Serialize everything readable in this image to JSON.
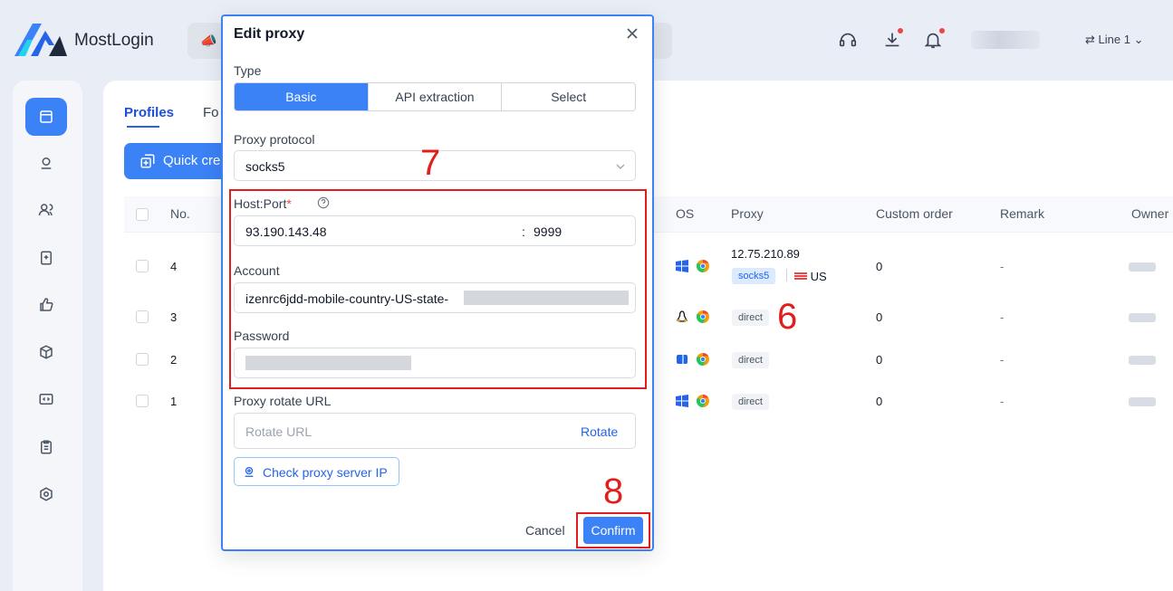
{
  "app": {
    "brand": "MostLogin",
    "line_select": "Line 1"
  },
  "icons": {
    "logo": "mostlogin-logo",
    "announce": "megaphone-icon",
    "support": "headset-icon",
    "download": "download-icon",
    "notification": "bell-icon",
    "line": "network-icon"
  },
  "colors": {
    "accent": "#3b82f6",
    "annotation": "#e11d1d",
    "alert": "#ef4444"
  },
  "main": {
    "tabs": [
      {
        "label": "Profiles"
      },
      {
        "label": "Fo"
      }
    ],
    "quick_create_label": "Quick cre",
    "table": {
      "columns": {
        "no": "No.",
        "os": "OS",
        "proxy": "Proxy",
        "custom_order": "Custom order",
        "remark": "Remark",
        "owner": "Owner"
      },
      "rows": [
        {
          "no": "4",
          "os": "windows",
          "proxy_ip": "12.75.210.89",
          "proxy_type": "socks5",
          "country": "US",
          "custom_order": "0",
          "remark": "-"
        },
        {
          "no": "3",
          "os": "linux",
          "proxy": "direct",
          "custom_order": "0",
          "remark": "-"
        },
        {
          "no": "2",
          "os": "macos",
          "proxy": "direct",
          "custom_order": "0",
          "remark": "-"
        },
        {
          "no": "1",
          "os": "windows",
          "proxy": "direct",
          "custom_order": "0",
          "remark": "-"
        }
      ]
    }
  },
  "modal": {
    "title": "Edit proxy",
    "type_label": "Type",
    "type_options": [
      "Basic",
      "API extraction",
      "Select"
    ],
    "type_selected": "Basic",
    "protocol_label": "Proxy protocol",
    "protocol_value": "socks5",
    "host_port_label": "Host:Port",
    "required_mark": "*",
    "host_value": "93.190.143.48",
    "colon": ":",
    "port_value": "9999",
    "account_label": "Account",
    "account_value": "izenrc6jdd-mobile-country-US-state-",
    "password_label": "Password",
    "rotate_label": "Proxy rotate URL",
    "rotate_placeholder": "Rotate URL",
    "rotate_button": "Rotate",
    "check_ip_button": "Check proxy server IP",
    "cancel_button": "Cancel",
    "confirm_button": "Confirm"
  },
  "annotations": [
    "7",
    "6",
    "8"
  ]
}
